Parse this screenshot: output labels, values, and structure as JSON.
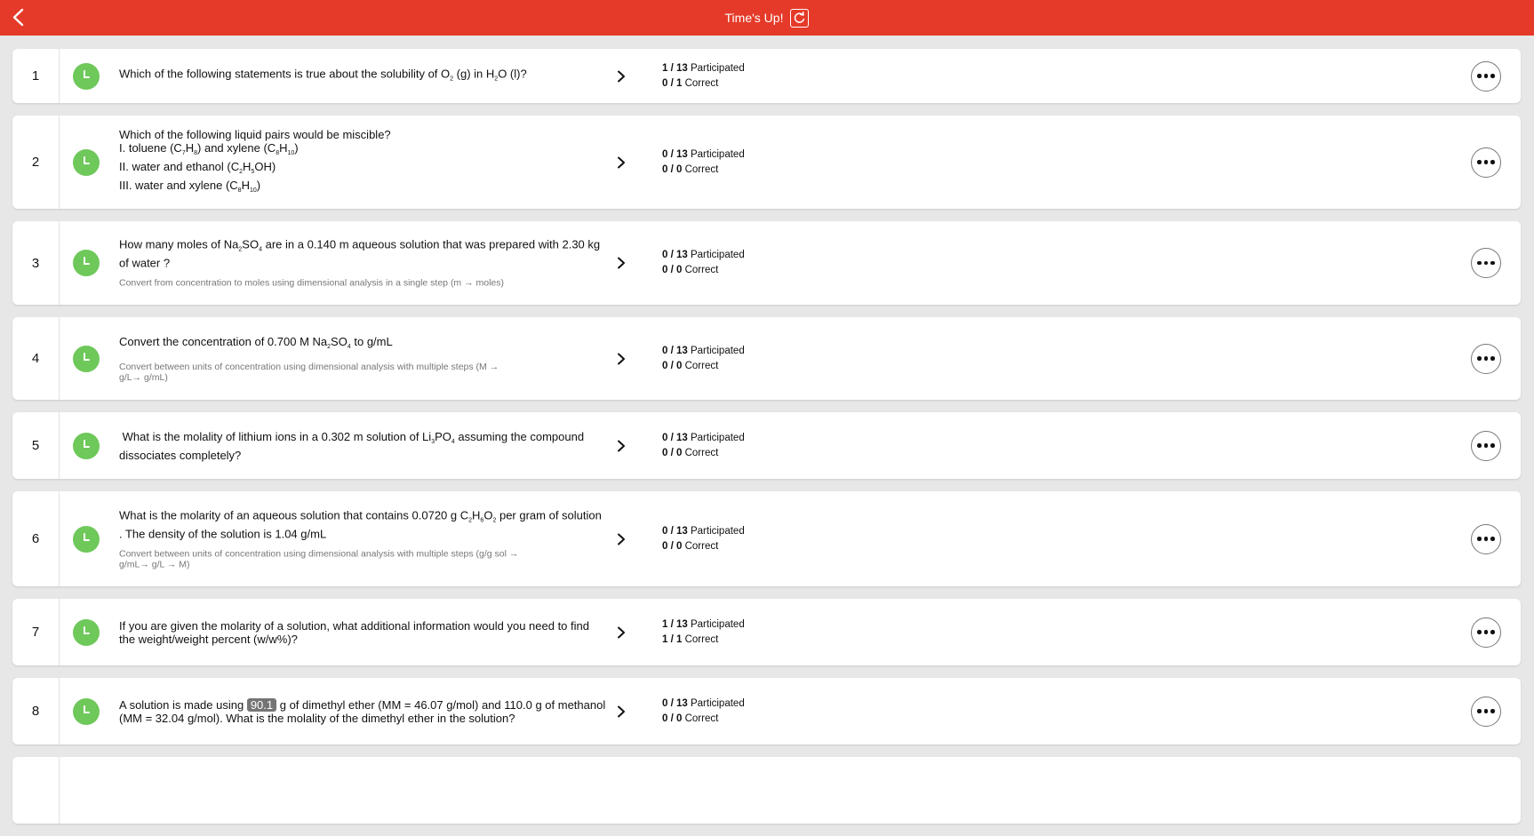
{
  "header": {
    "title": "Time's Up!"
  },
  "questions": [
    {
      "number": "1",
      "lines": [
        {
          "text": "Which of the following statements is true about the solubility of O<sub>2</sub> (g) in H<sub>2</sub>O (l)?"
        }
      ],
      "objective": "",
      "participated": "1 / 13",
      "participated_label": "Participated",
      "correct": "0 / 1",
      "correct_label": "Correct"
    },
    {
      "number": "2",
      "lines": [
        {
          "text": "Which of the following liquid pairs would be miscible?"
        },
        {
          "text": "I. toluene (C<sub>7</sub>H<sub>8</sub>) and xylene (C<sub>8</sub>H<sub>10</sub>)"
        },
        {
          "text": "II. water and ethanol (C<sub>2</sub>H<sub>5</sub>OH)"
        },
        {
          "text": "III. water and xylene (C<sub>8</sub>H<sub>10</sub>)"
        }
      ],
      "objective": "",
      "participated": "0 / 13",
      "participated_label": "Participated",
      "correct": "0 / 0",
      "correct_label": "Correct"
    },
    {
      "number": "3",
      "lines": [
        {
          "text": "How many moles of Na<sub>2</sub>SO<sub>4</sub> are in a 0.140 m aqueous solution that was prepared with 2.30 kg of water ?"
        }
      ],
      "objective": "Convert from concentration to moles using dimensional analysis in a single step (m → moles)",
      "participated": "0 / 13",
      "participated_label": "Participated",
      "correct": "0 / 0",
      "correct_label": "Correct"
    },
    {
      "number": "4",
      "lines": [
        {
          "text": "Convert the concentration of 0.700 M Na<sub>2</sub>SO<sub>4</sub> to g/mL"
        }
      ],
      "objective": "Convert between units of concentration using dimensional analysis with multiple steps (M → g/L→ g/mL)",
      "participated": "0 / 13",
      "participated_label": "Participated",
      "correct": "0 / 0",
      "correct_label": "Correct"
    },
    {
      "number": "5",
      "lines": [
        {
          "text": " What is the molality of lithium ions in a 0.302 m solution of Li<sub>3</sub>PO<sub>4</sub> assuming the compound dissociates completely?"
        }
      ],
      "objective": "",
      "participated": "0 / 13",
      "participated_label": "Participated",
      "correct": "0 / 0",
      "correct_label": "Correct"
    },
    {
      "number": "6",
      "lines": [
        {
          "text": "What is the molarity of an aqueous solution that contains 0.0720 g C<sub>2</sub>H<sub>6</sub>O<sub>2</sub> per gram of solution . The density of the solution is 1.04 g/mL"
        }
      ],
      "objective": "Convert between units of concentration using dimensional analysis with multiple steps (g/g sol → g/mL→ g/L → M)",
      "participated": "0 / 13",
      "participated_label": "Participated",
      "correct": "0 / 0",
      "correct_label": "Correct"
    },
    {
      "number": "7",
      "lines": [
        {
          "text": "If you are given the molarity of a solution, what additional information would you need to find the weight/weight percent (w/w%)?"
        }
      ],
      "objective": "",
      "participated": "1 / 13",
      "participated_label": "Participated",
      "correct": "1 / 1",
      "correct_label": "Correct"
    },
    {
      "number": "8",
      "lines": [
        {
          "text": "A solution is made using <span class=\"highlight\">90.1</span> g of dimethyl ether (MM = 46.07 g/mol) and 110.0 g of methanol (MM = 32.04 g/mol). What is the molality of the dimethyl ether in the solution?"
        }
      ],
      "objective": "",
      "participated": "0 / 13",
      "participated_label": "Participated",
      "correct": "0 / 0",
      "correct_label": "Correct"
    },
    {
      "number": "",
      "lines": [],
      "objective": "",
      "participated": "",
      "participated_label": "",
      "correct": "",
      "correct_label": ""
    }
  ]
}
